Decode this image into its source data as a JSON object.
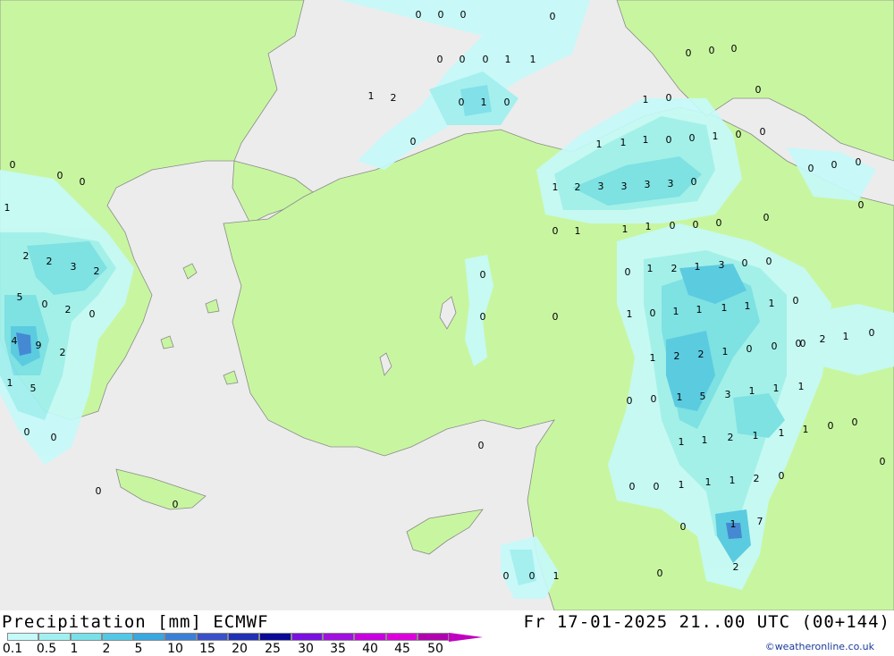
{
  "title": "Precipitation [mm] ECMWF",
  "datetime": "Fr 17-01-2025 21..00 UTC (00+144)",
  "credit": "©weatheronline.co.uk",
  "legend": {
    "labels": [
      "0.1",
      "0.5",
      "1",
      "2",
      "5",
      "10",
      "15",
      "20",
      "25",
      "30",
      "35",
      "40",
      "45",
      "50"
    ],
    "colors": [
      "#c6fafa",
      "#a0f0f0",
      "#78e0e8",
      "#52c8e6",
      "#38a8e0",
      "#3a80d8",
      "#3a50c8",
      "#2030b4",
      "#0a0a96",
      "#7a10e0",
      "#a010e0",
      "#c800e0",
      "#dc00dc",
      "#b000b0"
    ]
  },
  "map_colors": {
    "land": "#c8f6a0",
    "sea": "#ececec",
    "precip_light": "#c6fafa",
    "precip_low": "#a0f0f0",
    "precip_mid": "#78e0e8",
    "precip_high": "#52c8e6",
    "precip_strong": "#38a8e0",
    "precip_heavy": "#3a80d8"
  },
  "station_values": [
    "0",
    "0",
    "0",
    "0",
    "0",
    "0",
    "0",
    "1",
    "0",
    "0",
    "0",
    "0",
    "1",
    "2",
    "0",
    "0",
    "0",
    "0",
    "0",
    "1",
    "1",
    "0",
    "0",
    "0",
    "0",
    "1",
    "1",
    "1",
    "1",
    "0",
    "1",
    "0",
    "1",
    "0",
    "0",
    "0",
    "0",
    "1",
    "2",
    "3",
    "3",
    "3",
    "3",
    "0",
    "0",
    "0",
    "1",
    "1",
    "1",
    "0",
    "0",
    "0",
    "0",
    "2",
    "2",
    "3",
    "2",
    "5",
    "0",
    "0",
    "2",
    "0",
    "4",
    "9",
    "2",
    "1",
    "5",
    "0",
    "0",
    "0",
    "0",
    "0",
    "0",
    "1",
    "2",
    "1",
    "3",
    "0",
    "0",
    "0",
    "1",
    "0",
    "1",
    "1",
    "1",
    "1",
    "1",
    "0",
    "2",
    "1",
    "0",
    "1",
    "2",
    "2",
    "1",
    "0",
    "0",
    "0",
    "0",
    "0",
    "1",
    "5",
    "3",
    "1",
    "1",
    "1",
    "1",
    "1",
    "2",
    "1",
    "1",
    "1",
    "0",
    "0",
    "0",
    "0",
    "0",
    "1",
    "1",
    "2",
    "0",
    "0",
    "1",
    "7",
    "1",
    "2",
    "0",
    "0",
    "1",
    "0",
    "0",
    "0"
  ]
}
